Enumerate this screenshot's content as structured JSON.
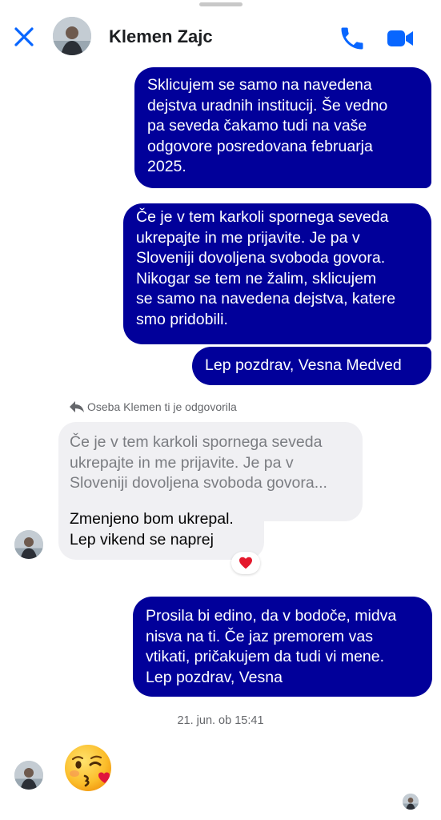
{
  "header": {
    "contact_name": "Klemen Zajc",
    "close_icon": "close-icon",
    "call_icon": "phone-icon",
    "video_icon": "video-camera-icon",
    "accent_color": "#0866ff"
  },
  "messages": {
    "out1": "Sklicujem se samo na navedena\ndejstva uradnih institucij. Še vedno\npa seveda čakamo tudi na vaše\nodgovore posredovana februarja\n2025.",
    "out2": "Če je v tem karkoli spornega seveda\nukrepajte in me prijavite. Je pa v\nSloveniji dovoljena svoboda govora.\nNikogar se tem ne žalim, sklicujem\nse samo na navedena dejstva, katere\nsmo pridobili.",
    "out3": "Lep pozdrav, Vesna Medved",
    "reply_label": "Oseba Klemen ti je odgovorila",
    "quoted": "Če je v tem karkoli spornega seveda\nukrepajte in me prijavite. Je pa v\nSloveniji dovoljena svoboda govora...",
    "in1": "Zmenjeno bom ukrepal.\nLep vikend se naprej",
    "reaction": "❤️",
    "out4": "Prosila bi edino, da v bodoče, midva\nnisva  na ti. Če jaz premorem  vas\nvtikati, pričakujem da tudi vi mene.\nLep pozdrav, Vesna",
    "timestamp": "21. jun. ob 15:41",
    "emoji": "😘"
  },
  "colors": {
    "outgoing_bubble": "#01009a",
    "incoming_bubble": "#f0f0f3"
  }
}
